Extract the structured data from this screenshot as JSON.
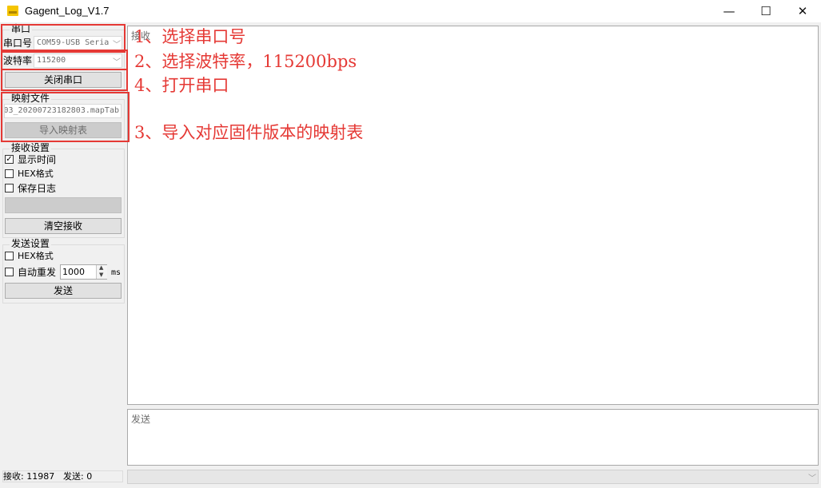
{
  "window": {
    "title": "Gagent_Log_V1.7",
    "minimize": "—",
    "maximize": "☐",
    "close": "✕"
  },
  "serial": {
    "group_title": "串口",
    "port_label": "串口号",
    "port_value": "COM59-USB Seria",
    "baud_label": "波特率",
    "baud_value": "115200",
    "toggle_button": "关闭串口"
  },
  "mapping": {
    "group_title": "映射文件",
    "file_value": "03_20200723182803.mapTab",
    "import_button": "导入映射表"
  },
  "receive_settings": {
    "group_title": "接收设置",
    "show_time": "显示时间",
    "show_time_checked": "✓",
    "hex_format": "HEX格式",
    "save_log": "保存日志",
    "clear_button": "清空接收"
  },
  "send_settings": {
    "group_title": "发送设置",
    "hex_format": "HEX格式",
    "auto_resend": "自动重发",
    "interval_value": "1000",
    "interval_unit": "ms",
    "send_button": "发送"
  },
  "panes": {
    "receive_placeholder": "接收",
    "send_placeholder": "发送"
  },
  "status": {
    "received": "接收: 11987",
    "sent": "发送: 0"
  },
  "annotations": {
    "step1": "1、选择串口号",
    "step2": "2、选择波特率，115200bps",
    "step4": "4、打开串口",
    "step3": "3、导入对应固件版本的映射表"
  },
  "colors": {
    "annotation_red": "#e53935",
    "app_icon": "#f5c400"
  }
}
